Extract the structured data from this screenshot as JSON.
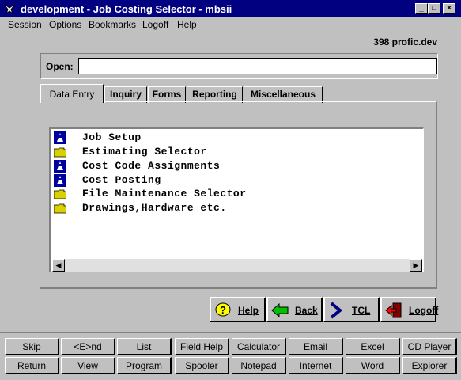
{
  "window": {
    "title": "development - Job Costing Selector - mbsii",
    "controls": [
      "_",
      "□",
      "×"
    ]
  },
  "menu": [
    {
      "label": "Session"
    },
    {
      "label": "Options"
    },
    {
      "label": "Bookmarks"
    },
    {
      "label": "Logoff"
    },
    {
      "label": "Help"
    }
  ],
  "connection": "398 profic.dev",
  "open": {
    "label": "Open:",
    "value": ""
  },
  "tabs": [
    {
      "label": "Data Entry",
      "active": true
    },
    {
      "label": "Inquiry"
    },
    {
      "label": "Forms"
    },
    {
      "label": "Reporting"
    },
    {
      "label": "Miscellaneous"
    }
  ],
  "list": [
    {
      "label": "Job Setup",
      "icon": "program-icon"
    },
    {
      "label": "Estimating Selector",
      "icon": "folder-icon"
    },
    {
      "label": "Cost Code Assignments",
      "icon": "program-icon"
    },
    {
      "label": "Cost Posting",
      "icon": "program-icon"
    },
    {
      "label": "File Maintenance Selector",
      "icon": "folder-icon"
    },
    {
      "label": "Drawings,Hardware etc.",
      "icon": "folder-icon"
    }
  ],
  "actions": [
    {
      "label": "Help",
      "icon": "help-icon"
    },
    {
      "label": "Back",
      "icon": "back-arrow-icon"
    },
    {
      "label": "TCL",
      "icon": "tcl-icon"
    },
    {
      "label": "Logoff",
      "icon": "logoff-icon"
    }
  ],
  "function_keys": {
    "row1": [
      "Skip",
      "<E>nd",
      "List",
      "Field Help",
      "Calculator",
      "Email",
      "Excel",
      "CD Player"
    ],
    "row2": [
      "Return",
      "View",
      "Program",
      "Spooler",
      "Notepad",
      "Internet",
      "Word",
      "Explorer"
    ]
  },
  "colors": {
    "titlebar": "#000080",
    "face": "#c0c0c0",
    "folder": "#d8d000",
    "program": "#0000a0"
  }
}
